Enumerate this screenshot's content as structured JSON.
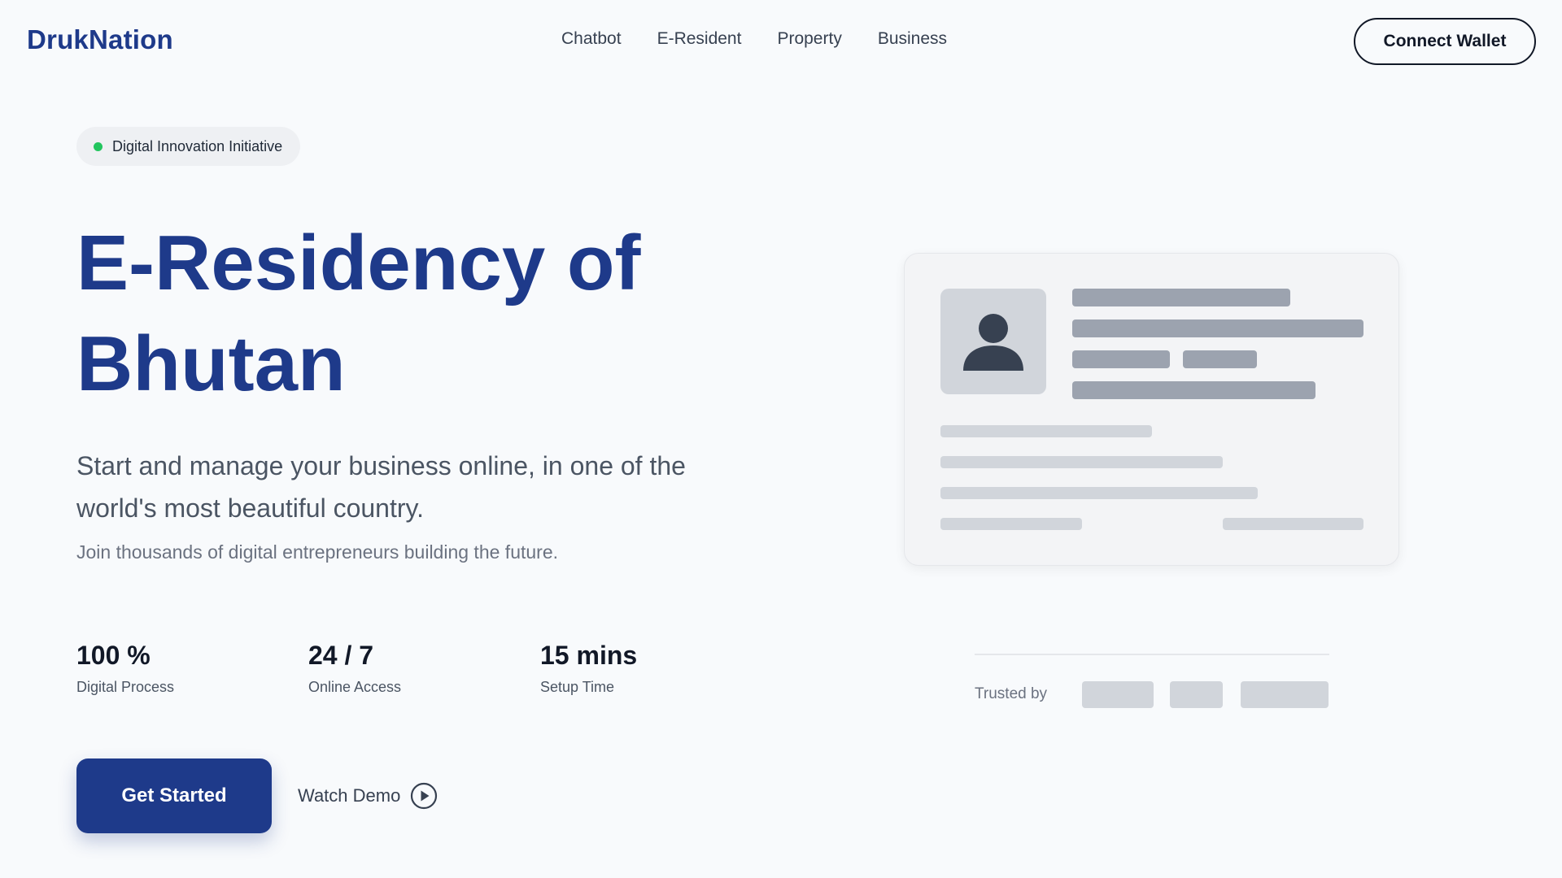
{
  "header": {
    "logo": "DrukNation",
    "nav": [
      "Chatbot",
      "E-Resident",
      "Property",
      "Business"
    ],
    "connect_wallet": "Connect Wallet"
  },
  "badge": {
    "text": "Digital Innovation Initiative",
    "dot_color": "#22c55e"
  },
  "hero": {
    "title_line1": "E-Residency of",
    "title_line2": "Bhutan",
    "subtitle_line1": "Start and manage your business online, in one of the",
    "subtitle_line2": "world's most beautiful country.",
    "note": "Join thousands of digital entrepreneurs building the future."
  },
  "stats": [
    {
      "value": "100 %",
      "label": "Digital Process"
    },
    {
      "value": "24 / 7",
      "label": "Online Access"
    },
    {
      "value": "15 mins",
      "label": "Setup Time"
    }
  ],
  "cta": {
    "get_started": "Get Started",
    "watch_demo": "Watch Demo",
    "watch_demo_icon": "play-circle-icon"
  },
  "illustration": {
    "avatar_icon": "user-icon"
  },
  "trusted": {
    "label": "Trusted by"
  },
  "colors": {
    "brand": "#1e3a8a",
    "background": "#f8fafc",
    "placeholder_dark": "#9ca3af",
    "placeholder_light": "#d1d5db"
  }
}
